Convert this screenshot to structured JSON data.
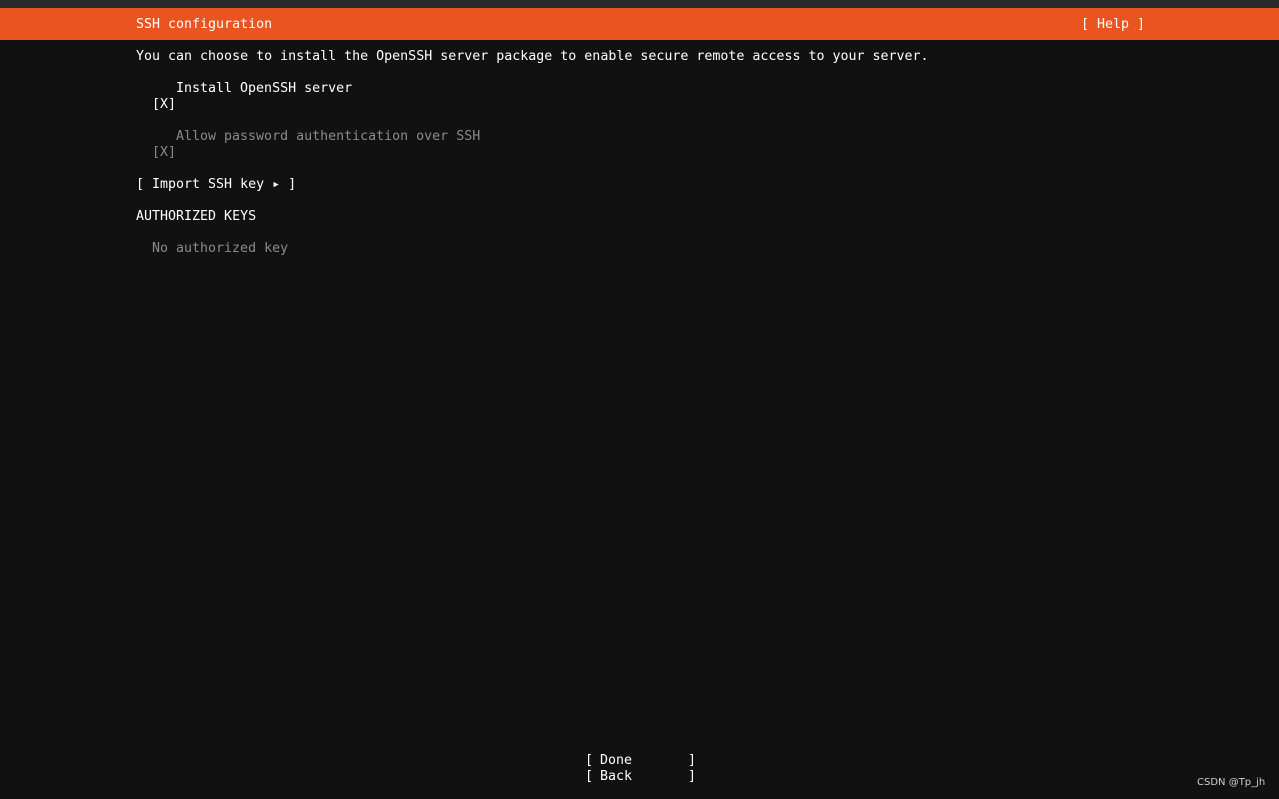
{
  "header": {
    "title": "SSH configuration",
    "help_label": "[ Help ]",
    "accent_color": "#e95420"
  },
  "intro": "You can choose to install the OpenSSH server package to enable secure remote access to your server.",
  "install_openssh": {
    "checkbox": "[X]",
    "label": "Install OpenSSH server"
  },
  "allow_password": {
    "checkbox": "[X]",
    "label": "Allow password authentication over SSH"
  },
  "import_key": {
    "label": "[ Import SSH key ▸ ]"
  },
  "authorized_keys": {
    "heading": "AUTHORIZED KEYS",
    "empty_text": "No authorized key"
  },
  "buttons": {
    "open_bracket": "[",
    "close_bracket": "]",
    "done": "Done",
    "back": "Back"
  },
  "watermark": "CSDN @Tp_jh"
}
